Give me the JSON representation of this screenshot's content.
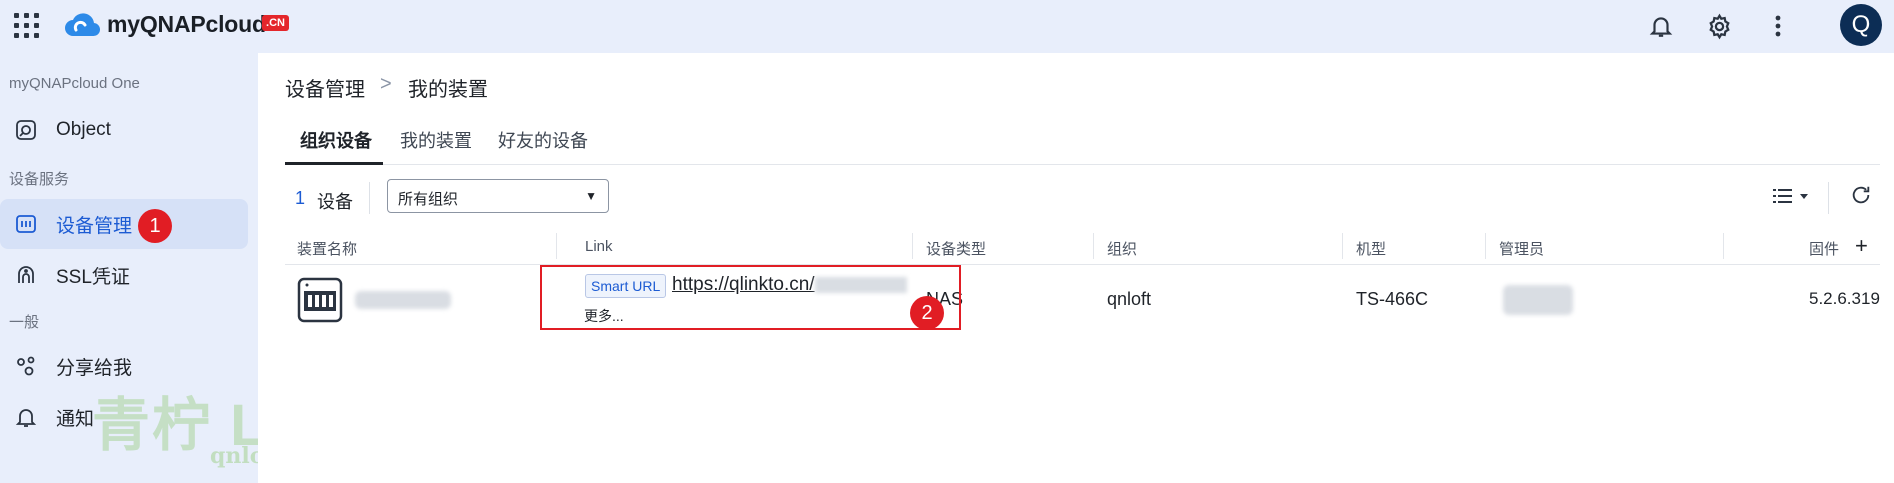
{
  "header": {
    "title": "myQNAPcloud",
    "badge": "CN",
    "avatar_initial": "Q",
    "icons": [
      "apps-grid-icon",
      "cloud-logo-icon",
      "bell-icon",
      "gear-icon",
      "more-vertical-icon"
    ]
  },
  "sidebar": {
    "sections": [
      {
        "label": "myQNAPcloud One",
        "items": [
          {
            "label": "Object",
            "icon": "object-storage-icon"
          }
        ]
      },
      {
        "label": "设备服务",
        "items": [
          {
            "label": "设备管理",
            "icon": "device-icon",
            "active": true,
            "marker": "1"
          },
          {
            "label": "SSL凭证",
            "icon": "certificate-icon"
          }
        ]
      },
      {
        "label": "一般",
        "items": [
          {
            "label": "分享给我",
            "icon": "share-icon"
          },
          {
            "label": "通知",
            "icon": "bell-icon"
          }
        ]
      }
    ]
  },
  "watermark": {
    "main": "青柠 L●ft",
    "sub": "qnloft.com"
  },
  "breadcrumb": {
    "root": "设备管理",
    "separator": ">",
    "current": "我的装置"
  },
  "tabs": [
    {
      "label": "组织设备",
      "active": true
    },
    {
      "label": "我的装置"
    },
    {
      "label": "好友的设备"
    }
  ],
  "toolbar": {
    "count": "1",
    "count_label": "设备",
    "filter_value": "所有组织"
  },
  "table": {
    "columns": [
      "装置名称",
      "Link",
      "设备类型",
      "组织",
      "机型",
      "管理员",
      "固件"
    ],
    "rows": [
      {
        "link_badge": "Smart URL",
        "link_url": "https://qlinkto.cn/",
        "link_more": "更多...",
        "type": "NAS",
        "org": "qnloft",
        "model": "TS-466C",
        "firmware": "5.2.6.319",
        "marker": "2"
      }
    ]
  },
  "colors": {
    "accent": "#1c5bd3",
    "highlight": "#e11d24",
    "sidebar_bg": "#e8eefb"
  }
}
